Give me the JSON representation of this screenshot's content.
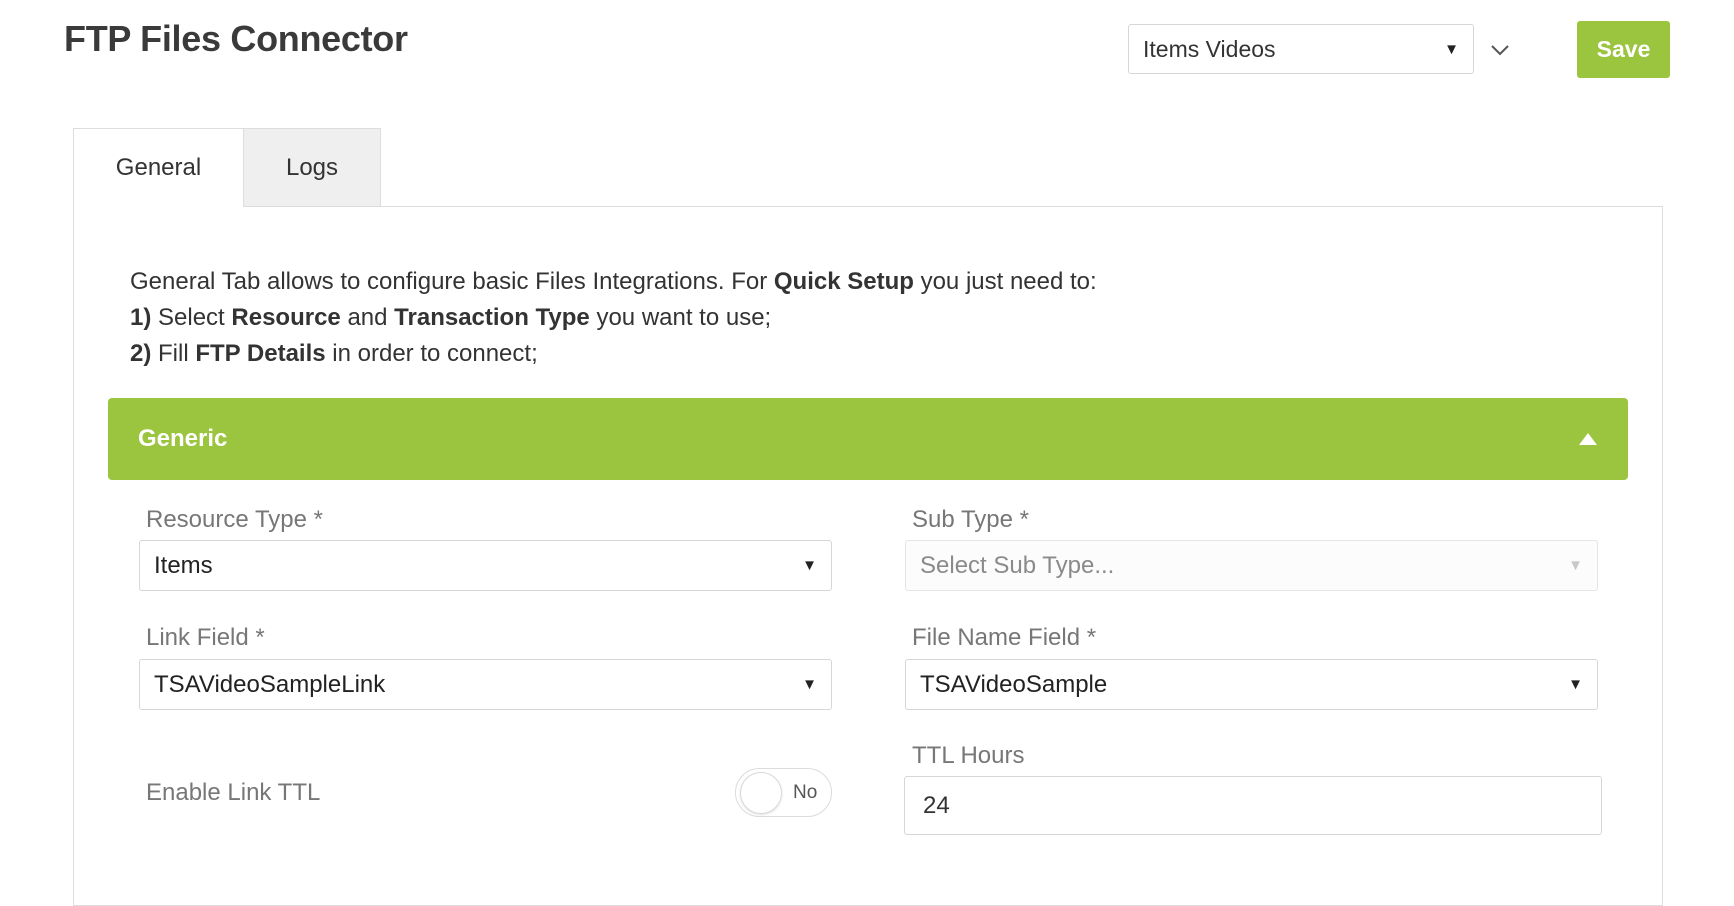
{
  "header": {
    "title": "FTP Files Connector",
    "config_select": {
      "value": "Items Videos"
    },
    "save_label": "Save"
  },
  "tabs": [
    {
      "label": "General",
      "active": true
    },
    {
      "label": "Logs",
      "active": false
    }
  ],
  "intro": {
    "line1": {
      "prefix": "General Tab allows to configure basic Files Integrations. For ",
      "bold": "Quick Setup",
      "suffix": " you just need to:"
    },
    "line2": {
      "num": "1)",
      "t1": " Select ",
      "b1": "Resource",
      "t2": " and ",
      "b2": "Transaction Type",
      "t3": " you want to use;"
    },
    "line3": {
      "num": "2)",
      "t1": " Fill ",
      "b1": "FTP Details",
      "t2": " in order to connect;"
    }
  },
  "section": {
    "title": "Generic",
    "header_color": "#9bc43f",
    "fields": {
      "resource_type": {
        "label": "Resource Type *",
        "value": "Items"
      },
      "sub_type": {
        "label": "Sub Type *",
        "placeholder": "Select Sub Type..."
      },
      "link_field": {
        "label": "Link Field *",
        "value": "TSAVideoSampleLink"
      },
      "file_name_field": {
        "label": "File Name Field *",
        "value": "TSAVideoSample"
      },
      "enable_link_ttl": {
        "label": "Enable Link TTL",
        "state": "No"
      },
      "ttl_hours": {
        "label": "TTL Hours",
        "value": "24"
      }
    }
  },
  "icons": {
    "dropdown_caret": "▼",
    "collapse": "▲",
    "chevron": "chevron-down"
  }
}
